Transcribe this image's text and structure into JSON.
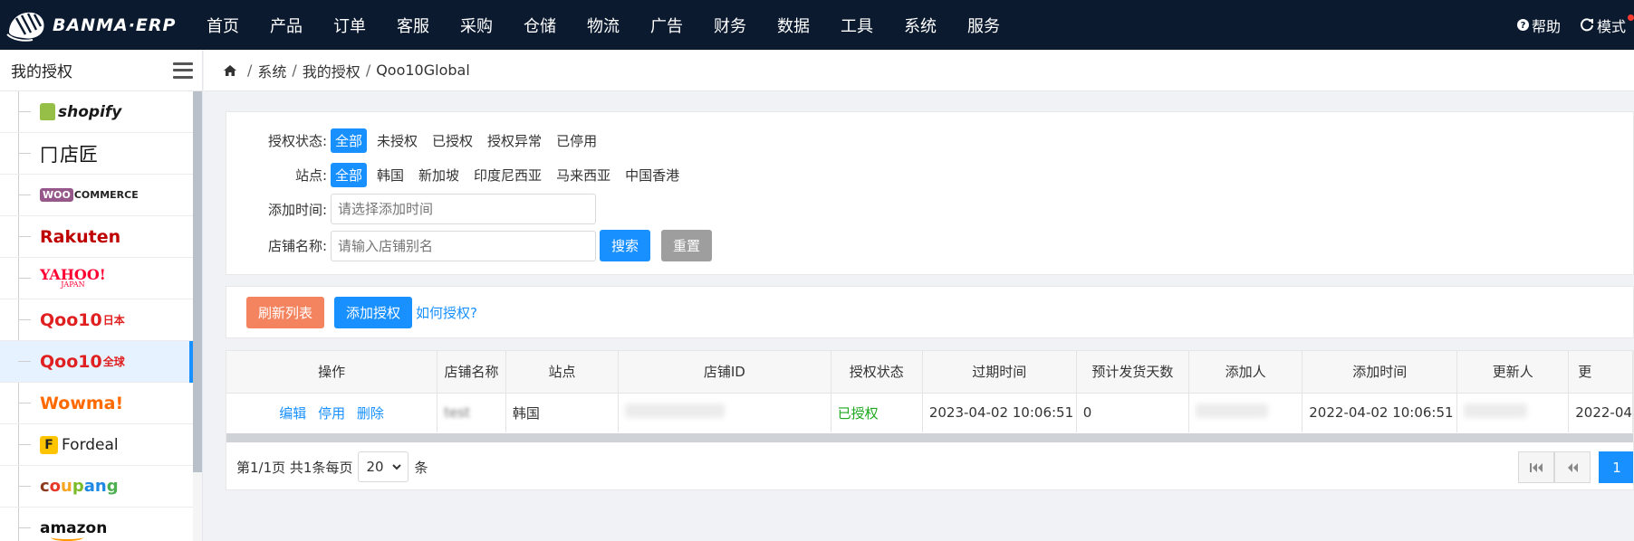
{
  "app": {
    "logo_text": "BANMA·ERP"
  },
  "nav": [
    "首页",
    "产品",
    "订单",
    "客服",
    "采购",
    "仓储",
    "物流",
    "广告",
    "财务",
    "数据",
    "工具",
    "系统",
    "服务"
  ],
  "top_right": {
    "help": "帮助",
    "mode": "模式"
  },
  "sidebar": {
    "title": "我的授权",
    "items": [
      {
        "label": "shopify",
        "icon": "shopify-logo"
      },
      {
        "label": "店匠",
        "icon": "dianjiang-logo"
      },
      {
        "label": "COMMERCE",
        "prefix": "WOO",
        "icon": "woocommerce-logo"
      },
      {
        "label": "Rakuten",
        "icon": "rakuten-logo"
      },
      {
        "label": "YAHOO!",
        "sub": "JAPAN",
        "icon": "yahoo-japan-logo"
      },
      {
        "label": "Qoo10",
        "suffix": "日本",
        "icon": "qoo10-japan-logo"
      },
      {
        "label": "Qoo10",
        "suffix": "全球",
        "icon": "qoo10-global-logo",
        "active": true
      },
      {
        "label": "Wowma!",
        "icon": "wowma-logo"
      },
      {
        "label": "Fordeal",
        "prefix": "F",
        "icon": "fordeal-logo"
      },
      {
        "label": "coupang",
        "icon": "coupang-logo"
      },
      {
        "label": "amazon",
        "icon": "amazon-logo"
      }
    ]
  },
  "breadcrumb": [
    "系统",
    "我的授权",
    "Qoo10Global"
  ],
  "filters": {
    "status_label": "授权状态:",
    "status_options": [
      "全部",
      "未授权",
      "已授权",
      "授权异常",
      "已停用"
    ],
    "site_label": "站点:",
    "site_options": [
      "全部",
      "韩国",
      "新加坡",
      "印度尼西亚",
      "马来西亚",
      "中国香港"
    ],
    "time_label": "添加时间:",
    "time_placeholder": "请选择添加时间",
    "name_label": "店铺名称:",
    "name_placeholder": "请输入店铺别名",
    "search_btn": "搜索",
    "reset_btn": "重置"
  },
  "toolbar": {
    "refresh": "刷新列表",
    "add": "添加授权",
    "howto": "如何授权?"
  },
  "table": {
    "columns": [
      "操作",
      "店铺名称",
      "站点",
      "店铺ID",
      "授权状态",
      "过期时间",
      "预计发货天数",
      "添加人",
      "添加时间",
      "更新人",
      "更"
    ],
    "row": {
      "ops": [
        "编辑",
        "停用",
        "删除"
      ],
      "shop_name": "test",
      "site": "韩国",
      "status": "已授权",
      "expire": "2023-04-02 10:06:51",
      "ship_days": "0",
      "add_time": "2022-04-02 10:06:51",
      "update_time": "2022-04"
    }
  },
  "pager": {
    "summary": "第1/1页 共1条每页",
    "page_size": "20",
    "unit": "条",
    "current": "1"
  },
  "colors": {
    "topbar": "#0b1a2f",
    "primary": "#1890ff",
    "orange": "#f4845f",
    "success": "#1ea81e"
  }
}
